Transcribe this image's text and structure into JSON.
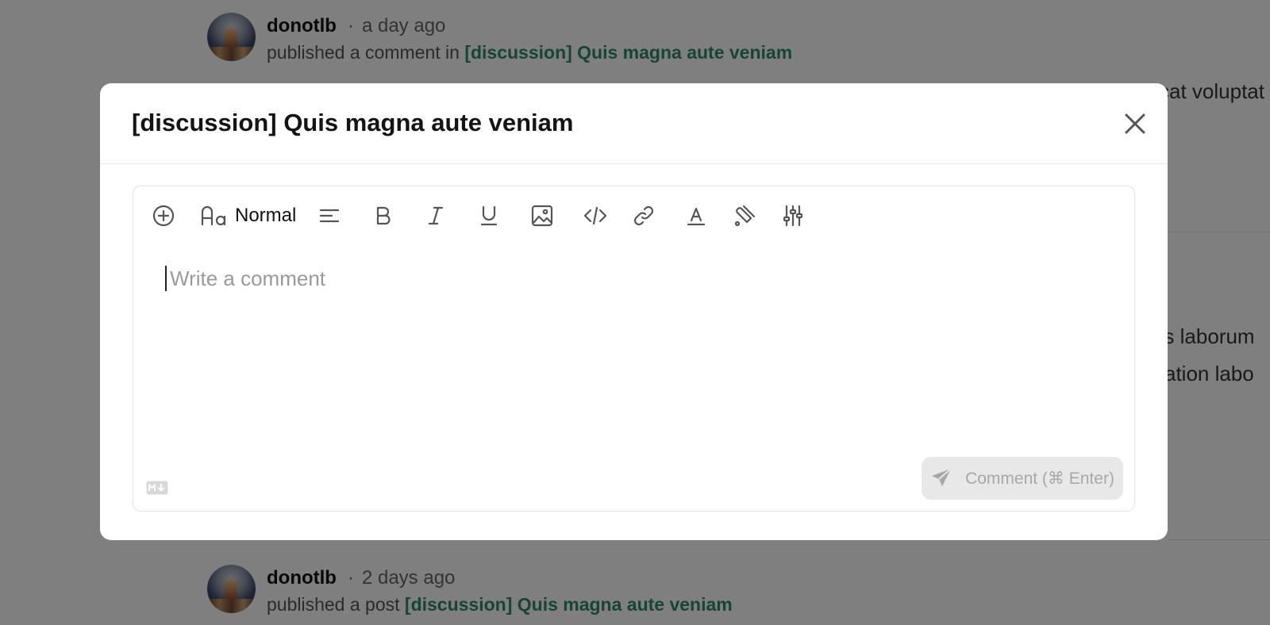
{
  "feed": {
    "entries": [
      {
        "username": "donotlb",
        "separator": "·",
        "time": "a day ago",
        "action": "published a comment in",
        "link": "[discussion] Quis magna aute veniam"
      },
      {
        "username": "donotlb",
        "separator": "·",
        "time": "2 days ago",
        "action": "published a post",
        "link": "[discussion] Quis magna aute veniam"
      }
    ],
    "snippets": [
      "cat voluptat",
      "ris laborum",
      "itation labo"
    ]
  },
  "modal": {
    "title": "[discussion] Quis magna aute veniam",
    "toolbar": {
      "font_style": "Normal"
    },
    "comment_placeholder": "Write a comment",
    "submit_label": "Comment (⌘ Enter)"
  },
  "colors": {
    "link": "#2f8a6a",
    "overlay": "rgba(0,0,0,0.5)"
  },
  "icons": [
    "plus-circle-icon",
    "font-size-icon",
    "align-left-icon",
    "bold-icon",
    "italic-icon",
    "underline-icon",
    "image-icon",
    "code-icon",
    "link-icon",
    "text-color-icon",
    "highlight-icon",
    "sliders-icon",
    "close-icon",
    "markdown-icon",
    "send-icon"
  ]
}
